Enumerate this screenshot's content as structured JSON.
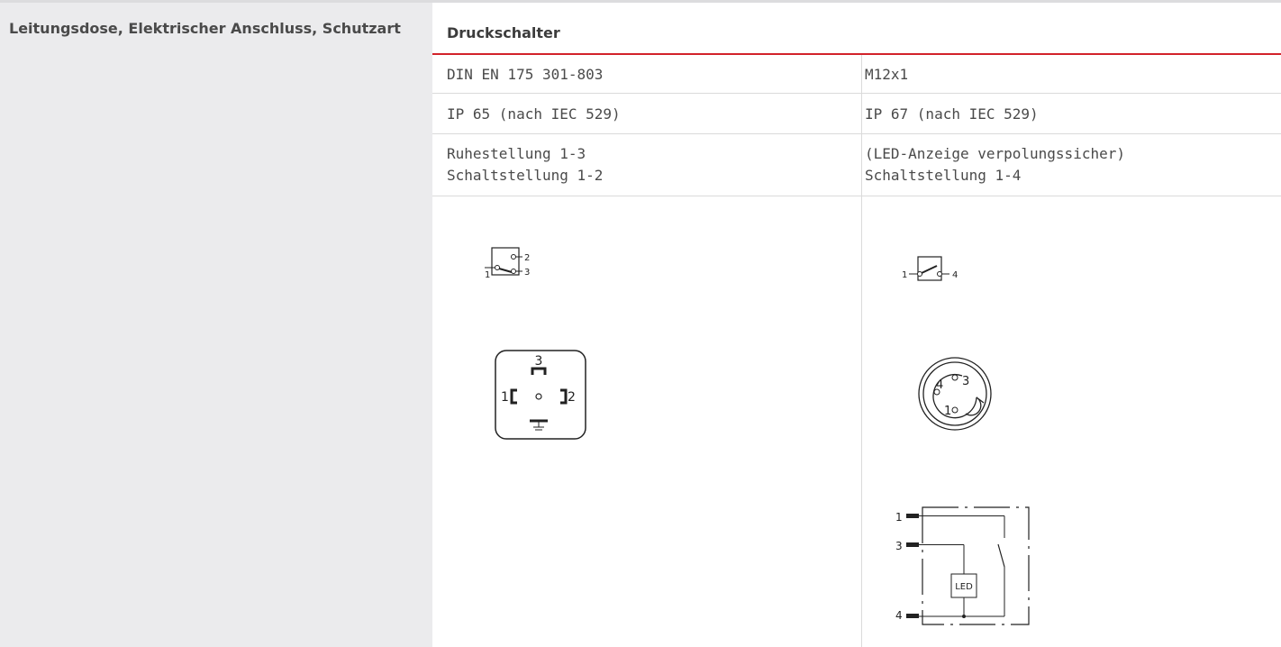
{
  "left": {
    "label": "Leitungsdose, Elektrischer Anschluss, Schutzart"
  },
  "table": {
    "header": "Druckschalter",
    "rows": [
      [
        "DIN EN 175 301-803",
        "M12x1"
      ],
      [
        "IP 65 (nach IEC 529)",
        "IP 67 (nach IEC 529)"
      ]
    ],
    "row3": {
      "left_line1": "Ruhestellung 1-3",
      "left_line2": "Schaltstellung 1-2",
      "right_line1": "(LED-Anzeige verpolungssicher)",
      "right_line2": "Schaltstellung 1-4"
    }
  },
  "diagrams": {
    "switch_a": {
      "pins": [
        "1",
        "2",
        "3"
      ]
    },
    "switch_b": {
      "pins": [
        "1",
        "4"
      ]
    },
    "din_connector": {
      "pins": [
        "1",
        "2",
        "3"
      ]
    },
    "m12_connector": {
      "pins": [
        "1",
        "3",
        "4"
      ]
    },
    "led_circuit": {
      "pins": [
        "1",
        "3",
        "4"
      ],
      "led_label": "LED"
    }
  }
}
